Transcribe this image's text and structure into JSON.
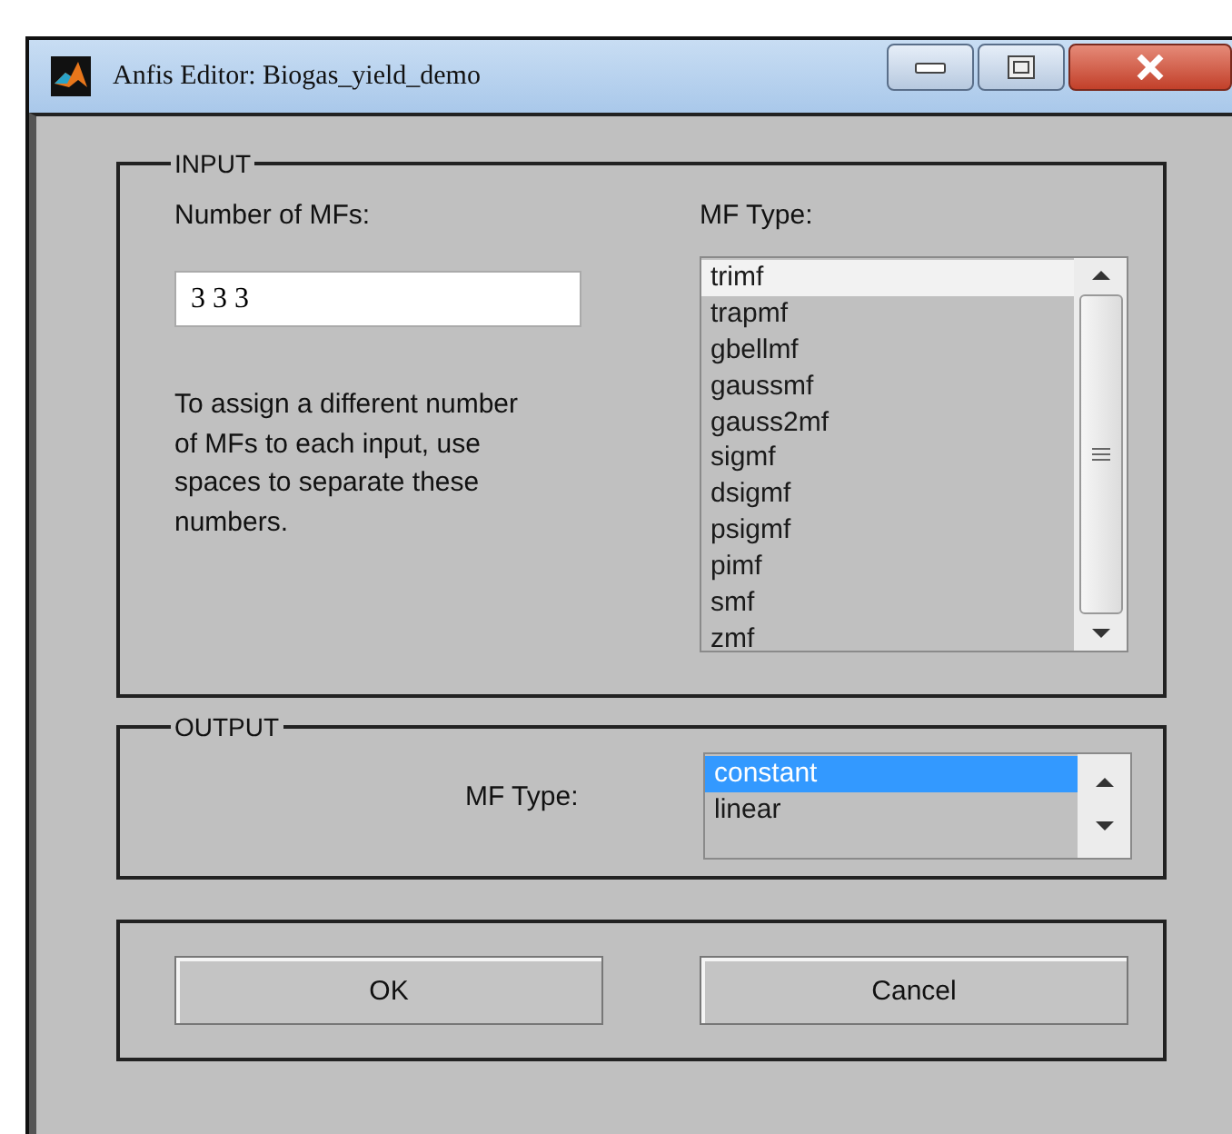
{
  "window": {
    "title": "Anfis Editor: Biogas_yield_demo"
  },
  "input": {
    "legend": "INPUT",
    "count_label": "Number of MFs:",
    "count_value": "3 3 3",
    "hint": "To assign a different number of MFs to each input, use spaces to separate these numbers.",
    "type_label": "MF Type:",
    "type_list": {
      "focused": false,
      "items": [
        {
          "label": "trimf",
          "selected": true
        },
        {
          "label": "trapmf",
          "selected": false
        },
        {
          "label": "gbellmf",
          "selected": false
        },
        {
          "label": "gaussmf",
          "selected": false
        },
        {
          "label": "gauss2mf",
          "selected": false
        },
        {
          "label": "sigmf",
          "selected": false
        },
        {
          "label": "dsigmf",
          "selected": false
        },
        {
          "label": "psigmf",
          "selected": false
        },
        {
          "label": "pimf",
          "selected": false
        },
        {
          "label": "smf",
          "selected": false
        },
        {
          "label": "zmf",
          "selected": false
        }
      ]
    }
  },
  "output": {
    "legend": "OUTPUT",
    "type_label": "MF Type:",
    "type_list": {
      "focused": true,
      "items": [
        {
          "label": "constant",
          "selected": true
        },
        {
          "label": "linear",
          "selected": false
        }
      ]
    }
  },
  "buttons": [
    "OK",
    "Cancel"
  ]
}
